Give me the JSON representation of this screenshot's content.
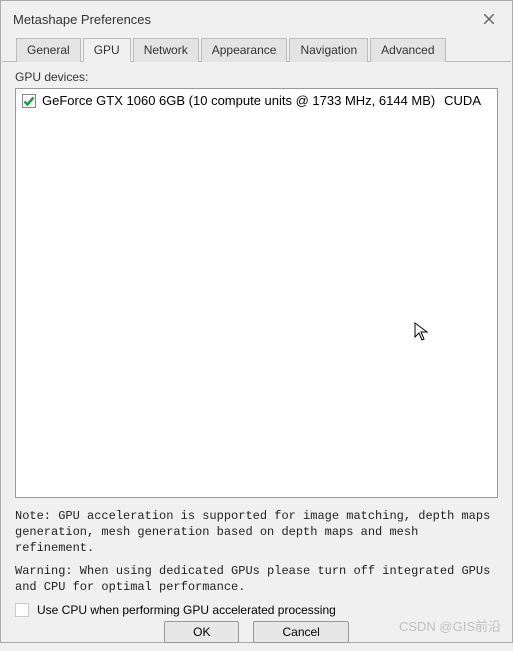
{
  "window": {
    "title": "Metashape Preferences"
  },
  "tabs": [
    {
      "label": "General"
    },
    {
      "label": "GPU"
    },
    {
      "label": "Network"
    },
    {
      "label": "Appearance"
    },
    {
      "label": "Navigation"
    },
    {
      "label": "Advanced"
    }
  ],
  "active_tab": 1,
  "gpu": {
    "section_label": "GPU devices:",
    "devices": [
      {
        "name": "GeForce GTX 1060 6GB (10 compute units @ 1733 MHz, 6144 MB)",
        "api": "CUDA",
        "checked": true
      }
    ],
    "note": "Note: GPU acceleration is supported for image matching, depth maps generation, mesh generation based on depth maps and mesh refinement.",
    "warning": "Warning: When using dedicated GPUs please turn off integrated GPUs and CPU for optimal performance.",
    "use_cpu_label": "Use CPU when performing GPU accelerated processing",
    "use_cpu_checked": false
  },
  "buttons": {
    "ok": "OK",
    "cancel": "Cancel"
  },
  "watermark": "CSDN @GIS前沿"
}
